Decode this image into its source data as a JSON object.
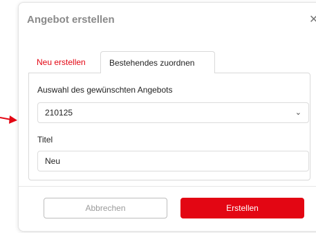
{
  "dialog": {
    "title": "Angebot erstellen",
    "close_icon": "close-icon"
  },
  "tabs": [
    {
      "label": "Neu erstellen",
      "active": false
    },
    {
      "label": "Bestehendes zuordnen",
      "active": true
    }
  ],
  "form": {
    "offer_label": "Auswahl des gewünschten Angebots",
    "offer_value": "210125",
    "title_label": "Titel",
    "title_value": "Neu"
  },
  "buttons": {
    "cancel_label": "Abbrechen",
    "create_label": "Erstellen"
  },
  "colors": {
    "accent": "#e30613",
    "muted_text": "#8a8a8a",
    "border": "#d9d9d9"
  },
  "icons": [
    "close-icon",
    "chevron-down-icon",
    "arrow-icon"
  ]
}
